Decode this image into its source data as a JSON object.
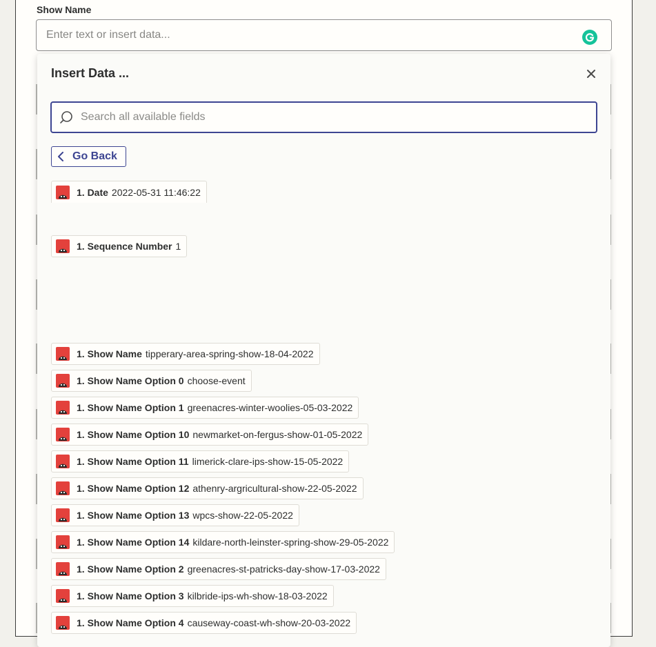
{
  "field": {
    "label": "Show Name",
    "placeholder": "Enter text or insert data..."
  },
  "popup": {
    "title": "Insert Data ...",
    "search_placeholder": "Search all available fields",
    "go_back_label": "Go Back",
    "items": [
      {
        "label": "1. Date",
        "value": "2022-05-31 11:46:22"
      },
      {
        "label": "1. Sequence Number",
        "value": "1"
      },
      {
        "label": "1. Show Name",
        "value": "tipperary-area-spring-show-18-04-2022"
      },
      {
        "label": "1. Show Name Option 0",
        "value": "choose-event"
      },
      {
        "label": "1. Show Name Option 1",
        "value": "greenacres-winter-woolies-05-03-2022"
      },
      {
        "label": "1. Show Name Option 10",
        "value": "newmarket-on-fergus-show-01-05-2022"
      },
      {
        "label": "1. Show Name Option 11",
        "value": "limerick-clare-ips-show-15-05-2022"
      },
      {
        "label": "1. Show Name Option 12",
        "value": "athenry-argricultural-show-22-05-2022"
      },
      {
        "label": "1. Show Name Option 13",
        "value": "wpcs-show-22-05-2022"
      },
      {
        "label": "1. Show Name Option 14",
        "value": "kildare-north-leinster-spring-show-29-05-2022"
      },
      {
        "label": "1. Show Name Option 2",
        "value": "greenacres-st-patricks-day-show-17-03-2022"
      },
      {
        "label": "1. Show Name Option 3",
        "value": "kilbride-ips-wh-show-18-03-2022"
      },
      {
        "label": "1. Show Name Option 4",
        "value": "causeway-coast-wh-show-20-03-2022"
      }
    ]
  },
  "colors": {
    "accent": "#3d4592",
    "app_icon": "#e3413c",
    "grammarly": "#15c39a"
  }
}
